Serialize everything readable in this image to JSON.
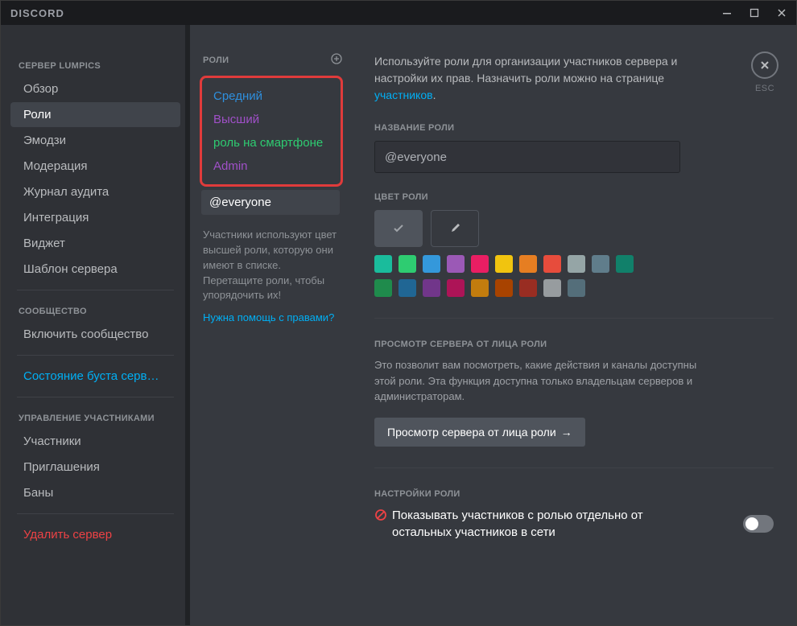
{
  "window": {
    "title": "DISCORD"
  },
  "esc_label": "ESC",
  "sidebar": {
    "headers": {
      "server": "СЕРВЕР LUMPICS",
      "community": "СООБЩЕСТВО",
      "members_mgmt": "УПРАВЛЕНИЕ УЧАСТНИКАМИ"
    },
    "items": {
      "overview": "Обзор",
      "roles": "Роли",
      "emoji": "Эмодзи",
      "moderation": "Модерация",
      "audit": "Журнал аудита",
      "integration": "Интеграция",
      "widget": "Виджет",
      "template": "Шаблон сервера",
      "enable_community": "Включить сообщество",
      "boost_status": "Состояние буста серв…",
      "members": "Участники",
      "invites": "Приглашения",
      "bans": "Баны",
      "delete": "Удалить сервер"
    }
  },
  "roles_column": {
    "title": "РОЛИ",
    "roles": [
      {
        "label": "Средний",
        "color": "#2e8fdd"
      },
      {
        "label": "Высший",
        "color": "#a050c8"
      },
      {
        "label": "роль на смартфоне",
        "color": "#2ecc71"
      },
      {
        "label": "Admin",
        "color": "#a050c8"
      }
    ],
    "everyone": "@everyone",
    "note": "Участники используют цвет высшей роли, которую они имеют в списке. Перетащите роли, чтобы упорядочить их!",
    "help": "Нужна помощь с правами?"
  },
  "main": {
    "description_prefix": "Используйте роли для организации участников сервера и настройки их прав. Назначить роли можно на странице ",
    "description_link": "участников",
    "description_suffix": ".",
    "role_name_label": "НАЗВАНИЕ РОЛИ",
    "role_name_value": "@everyone",
    "role_color_label": "ЦВЕТ РОЛИ",
    "default_swatch": "#4f545c",
    "colors_row1": [
      "#1abc9c",
      "#2ecc71",
      "#3498db",
      "#9b59b6",
      "#e91e63",
      "#f1c40f",
      "#e67e22",
      "#e74c3c",
      "#95a5a6",
      "#607d8b"
    ],
    "colors_row2": [
      "#11806a",
      "#1f8b4c",
      "#206694",
      "#71368a",
      "#ad1457",
      "#c27c0e",
      "#a84300",
      "#992d22",
      "#979c9f",
      "#546e7a"
    ],
    "view_section_label": "ПРОСМОТР СЕРВЕРА ОТ ЛИЦА РОЛИ",
    "view_section_desc": "Это позволит вам посмотреть, какие действия и каналы доступны этой роли. Эта функция доступна только владельцам серверов и администраторам.",
    "view_button": "Просмотр сервера от лица роли",
    "settings_label": "НАСТРОЙКИ РОЛИ",
    "setting1": "Показывать участников с ролью отдельно от остальных участников в сети"
  }
}
